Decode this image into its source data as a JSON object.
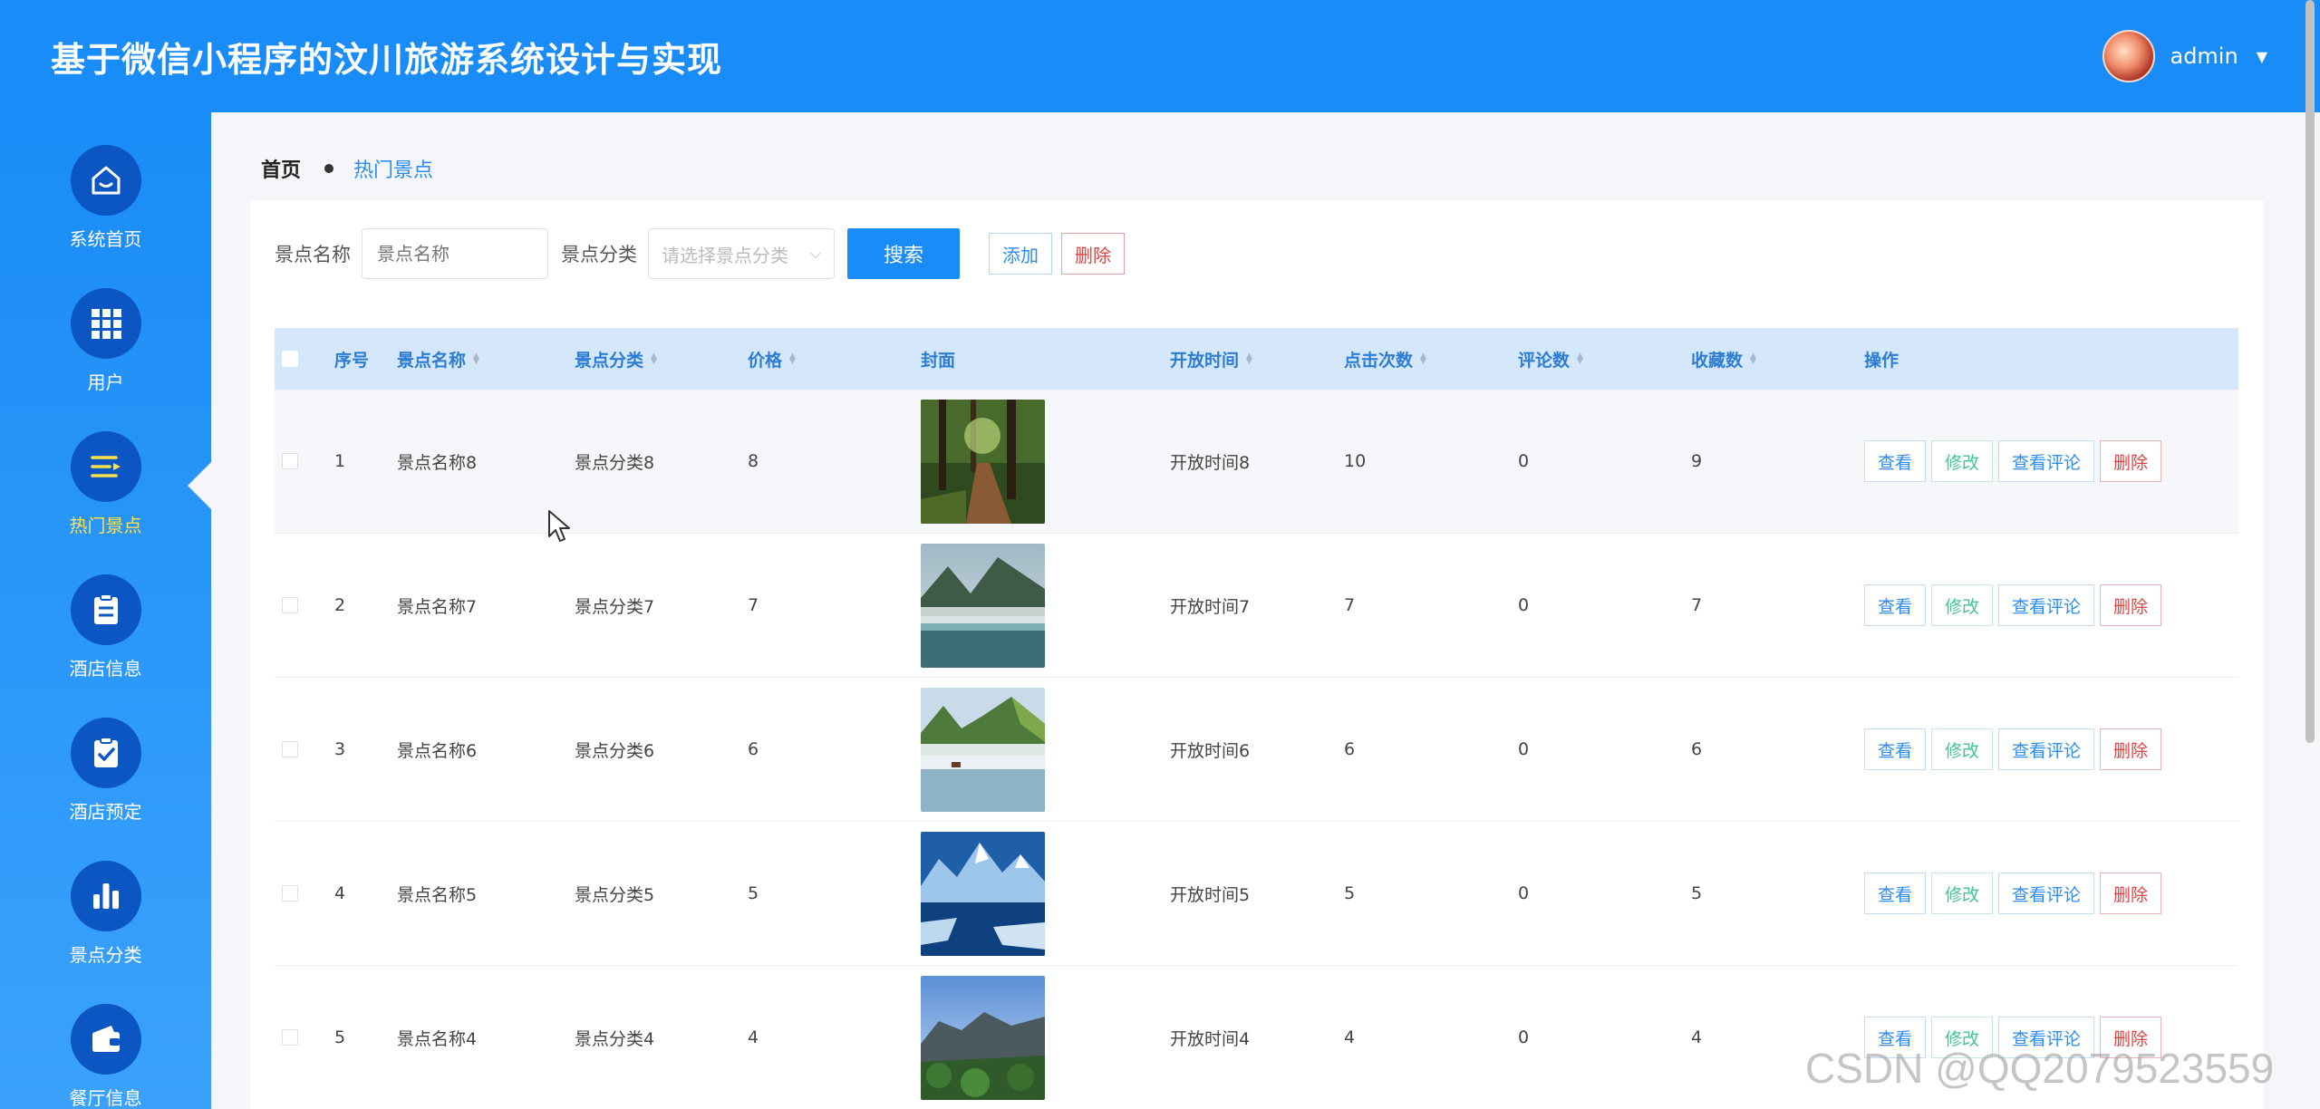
{
  "header": {
    "title": "基于微信小程序的汶川旅游系统设计与实现",
    "username": "admin"
  },
  "sidebar": {
    "items": [
      {
        "label": "系统首页",
        "icon": "home-icon"
      },
      {
        "label": "用户",
        "icon": "grid-icon"
      },
      {
        "label": "热门景点",
        "icon": "list-icon",
        "active": true
      },
      {
        "label": "酒店信息",
        "icon": "clipboard-icon"
      },
      {
        "label": "酒店预定",
        "icon": "clipboard-check-icon"
      },
      {
        "label": "景点分类",
        "icon": "bar-chart-icon"
      },
      {
        "label": "餐厅信息",
        "icon": "wallet-icon"
      }
    ]
  },
  "breadcrumb": {
    "home": "首页",
    "current": "热门景点"
  },
  "toolbar": {
    "name_label": "景点名称",
    "name_placeholder": "景点名称",
    "category_label": "景点分类",
    "category_placeholder": "请选择景点分类",
    "search_label": "搜索",
    "add_label": "添加",
    "delete_label": "删除"
  },
  "table": {
    "headers": [
      "序号",
      "景点名称",
      "景点分类",
      "价格",
      "封面",
      "开放时间",
      "点击次数",
      "评论数",
      "收藏数",
      "操作"
    ],
    "rows": [
      {
        "idx": "1",
        "name": "景点名称8",
        "category": "景点分类8",
        "price": "8",
        "time": "开放时间8",
        "clicks": "10",
        "comments": "0",
        "favs": "9"
      },
      {
        "idx": "2",
        "name": "景点名称7",
        "category": "景点分类7",
        "price": "7",
        "time": "开放时间7",
        "clicks": "7",
        "comments": "0",
        "favs": "7"
      },
      {
        "idx": "3",
        "name": "景点名称6",
        "category": "景点分类6",
        "price": "6",
        "time": "开放时间6",
        "clicks": "6",
        "comments": "0",
        "favs": "6"
      },
      {
        "idx": "4",
        "name": "景点名称5",
        "category": "景点分类5",
        "price": "5",
        "time": "开放时间5",
        "clicks": "5",
        "comments": "0",
        "favs": "5"
      },
      {
        "idx": "5",
        "name": "景点名称4",
        "category": "景点分类4",
        "price": "4",
        "time": "开放时间4",
        "clicks": "4",
        "comments": "0",
        "favs": "4"
      }
    ],
    "ops": {
      "view": "查看",
      "edit": "修改",
      "comments": "查看评论",
      "delete": "删除"
    }
  },
  "watermark": "CSDN @QQ2079523559",
  "colors": {
    "header_bg": "#1a8cf7",
    "sidebar_icon_bg": "#0b56c3",
    "active_label": "#ffe14d",
    "table_header_bg": "#d4e7fb",
    "primary": "#2d8cf0",
    "danger": "#e04343",
    "success": "#45c296"
  }
}
